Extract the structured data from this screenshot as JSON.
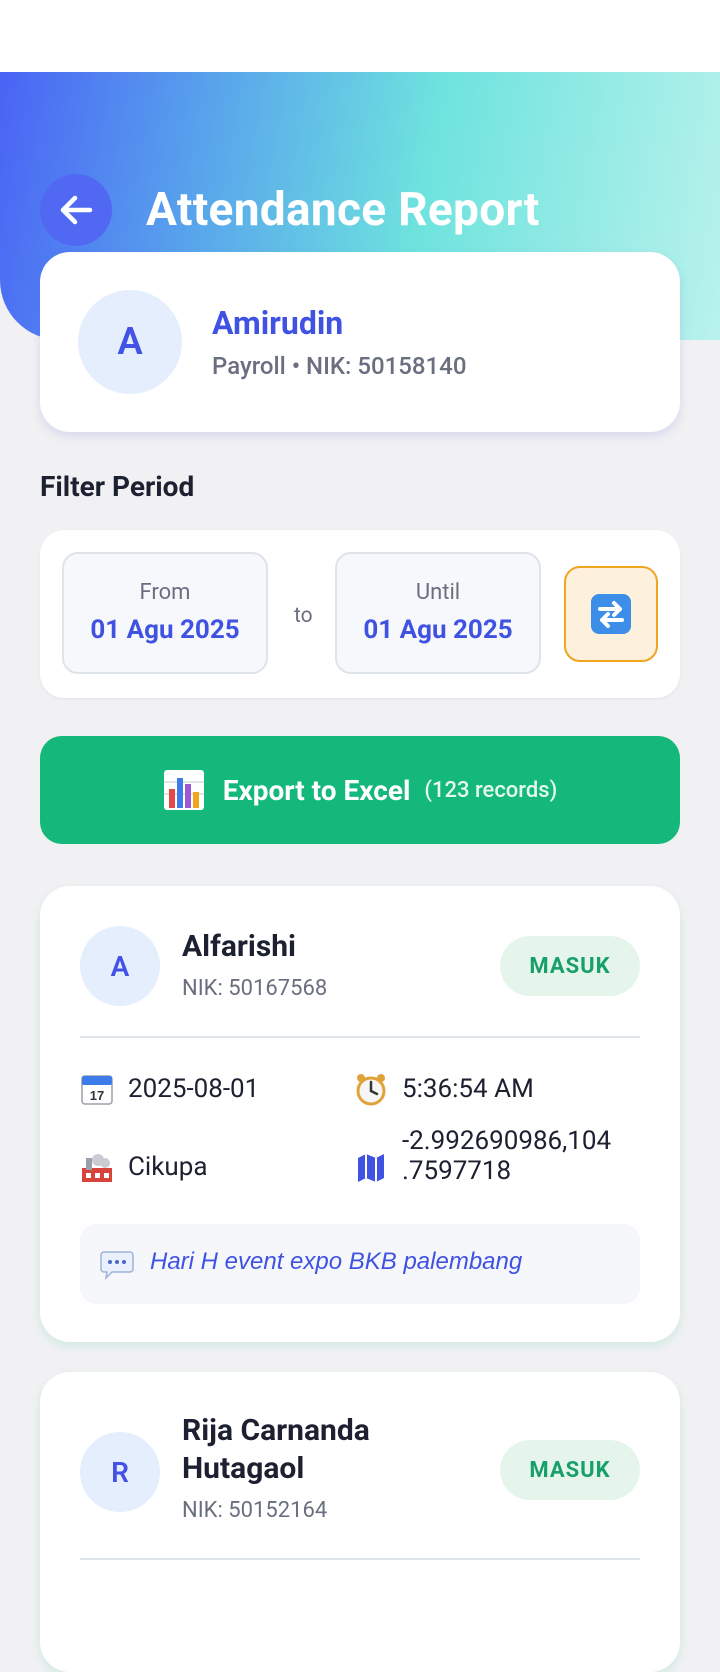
{
  "header": {
    "title": "Attendance Report",
    "back_icon": "arrow-left-icon"
  },
  "profile": {
    "initial": "A",
    "name": "Amirudin",
    "subtitle": "Payroll • NIK: 50158140"
  },
  "filter": {
    "section_label": "Filter Period",
    "from_label": "From",
    "from_value": "01 Agu 2025",
    "to_label": "to",
    "until_label": "Until",
    "until_value": "01 Agu 2025",
    "refresh_icon": "refresh-arrows-icon"
  },
  "export": {
    "label": "Export to Excel",
    "count_label": "(123 records)",
    "icon": "bar-chart-icon"
  },
  "records": [
    {
      "initial": "A",
      "name": "Alfarishi",
      "nik": "NIK: 50167568",
      "status": "MASUK",
      "date": "2025-08-01",
      "time": "5:36:54 AM",
      "location": "Cikupa",
      "coords_line1": "-2.992690986,104",
      "coords_line2": ".7597718",
      "note": "Hari H event expo BKB palembang"
    },
    {
      "initial": "R",
      "name_line1": "Rija Carnanda",
      "name_line2": "Hutagaol",
      "nik": "NIK: 50152164",
      "status": "MASUK"
    }
  ],
  "colors": {
    "accent": "#3f52e2",
    "success": "#14b87b",
    "badge_bg": "#e6f5ec",
    "badge_text": "#17a06b",
    "warning": "#f0a51f"
  }
}
